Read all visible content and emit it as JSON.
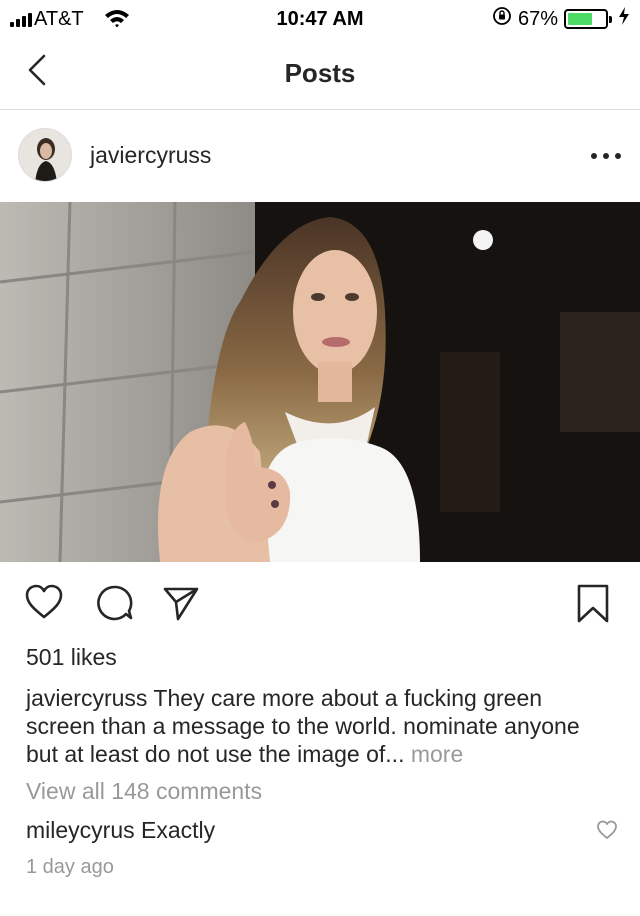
{
  "status_bar": {
    "carrier": "AT&T",
    "time": "10:47 AM",
    "battery": "67%",
    "battery_level": 0.67,
    "icons": [
      "signal-icon",
      "wifi-icon",
      "orientation-lock-icon",
      "battery-icon",
      "charging-icon"
    ]
  },
  "nav": {
    "title": "Posts",
    "back_icon": "chevron-left-icon"
  },
  "post": {
    "username": "javiercyruss",
    "more_icon": "ellipsis-icon",
    "photo_alt": "photo",
    "likes": "501 likes",
    "caption_username": "javiercyruss",
    "caption_text": " They care more about a fucking green screen than a message to the world.  nominate anyone but at least do not use the image of...",
    "caption_more": " more",
    "view_comments": "View all 148 comments",
    "comment": {
      "username": "mileycyrus",
      "text": " Exactly"
    },
    "time_ago": "1 day ago"
  },
  "actions": {
    "icons": [
      "heart-icon",
      "comment-icon",
      "share-icon",
      "bookmark-icon"
    ]
  },
  "colors": {
    "text": "#262626",
    "muted": "#999999",
    "divider": "#dbdbdb",
    "battery_green": "#4cd964"
  }
}
